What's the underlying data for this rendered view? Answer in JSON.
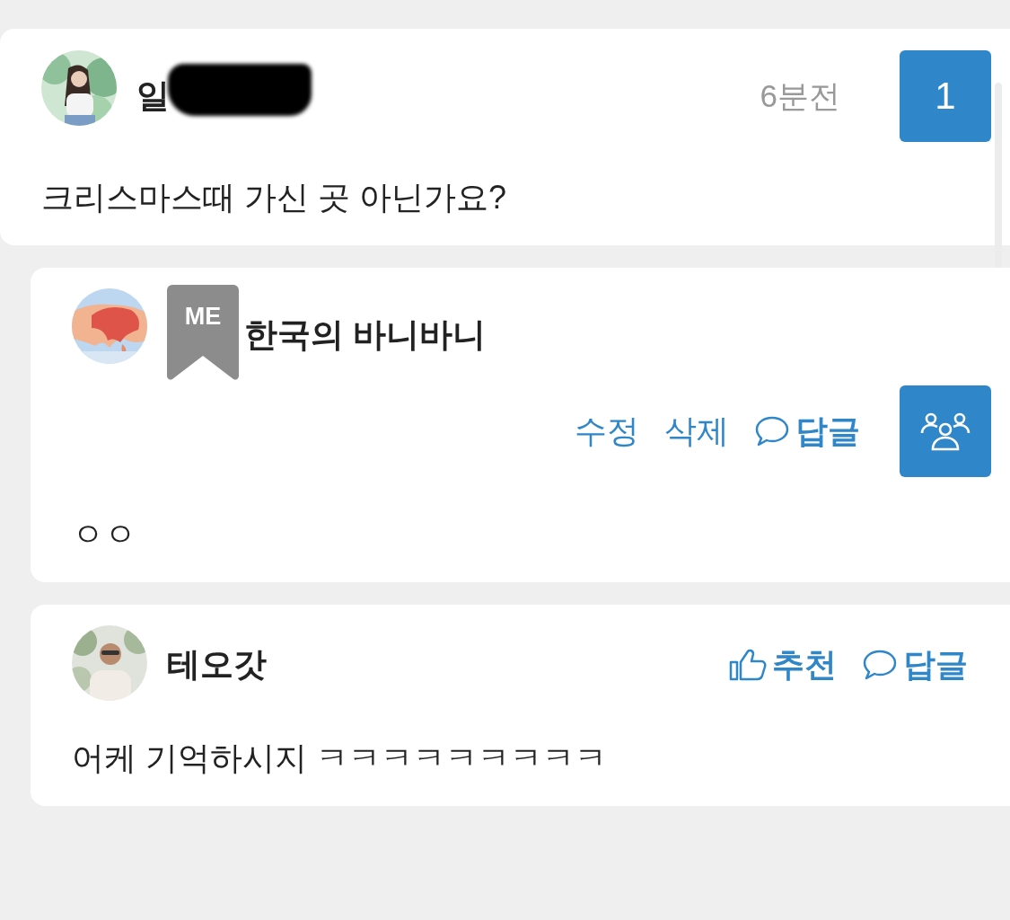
{
  "comments": [
    {
      "kind": "comment",
      "author": "일",
      "redacted": true,
      "time": "6분전",
      "badge": "1",
      "text": "크리스마스때 가신 곳 아닌가요?"
    },
    {
      "kind": "reply",
      "author": "한국의 바니바니",
      "me_tag": "ME",
      "actions": [
        {
          "kind": "edit",
          "label": "수정"
        },
        {
          "kind": "delete",
          "label": "삭제"
        },
        {
          "kind": "reply",
          "label": "답글"
        }
      ],
      "group_button": true,
      "text": "ㅇㅇ"
    },
    {
      "kind": "reply",
      "author": "테오갓",
      "actions": [
        {
          "kind": "like",
          "label": "추천"
        },
        {
          "kind": "reply",
          "label": "답글"
        }
      ],
      "text": "어케 기억하시지 ㅋㅋㅋㅋㅋㅋㅋㅋㅋ"
    }
  ]
}
